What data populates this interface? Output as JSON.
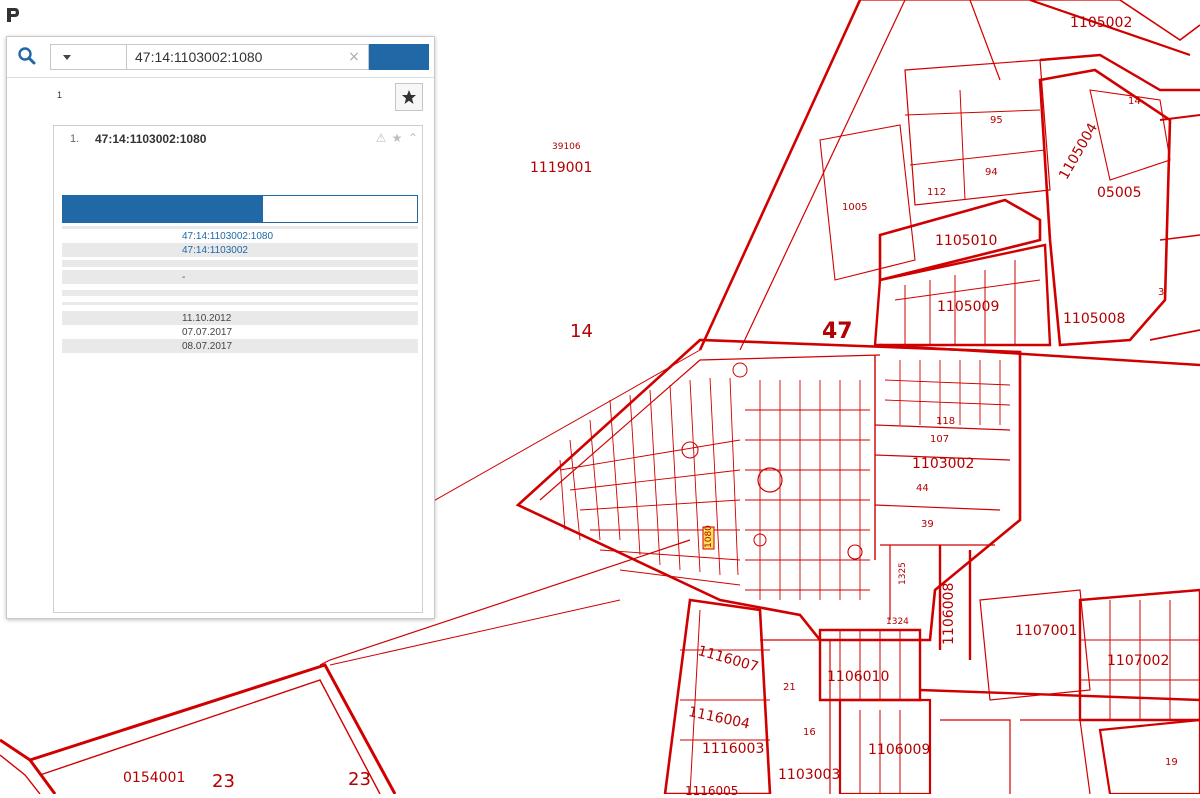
{
  "header": {
    "title": ""
  },
  "search": {
    "type_label": "",
    "query": "47:14:1103002:1080",
    "clear_glyph": "×",
    "button_label": ""
  },
  "results": {
    "title": "",
    "count": "1",
    "favorite_glyph": "★",
    "items": [
      {
        "index": "1.",
        "cad_number": "47:14:1103002:1080",
        "address": "",
        "icons": {
          "warning": "⚠",
          "star": "★",
          "collapse": "⌃"
        },
        "links": {
          "plan_zu": "",
          "plan_kk": "",
          "search_in_bounds": ""
        }
      }
    ]
  },
  "tabs": {
    "info": "",
    "services": ""
  },
  "info": {
    "rows": [
      {
        "key": "",
        "value": ""
      },
      {
        "key": "",
        "value": "47:14:1103002:1080"
      },
      {
        "key": "",
        "value": "47:14:1103002"
      },
      {
        "key": "",
        "value": ""
      },
      {
        "key": "",
        "value": ""
      },
      {
        "key": "",
        "value": ""
      },
      {
        "key": "",
        "value": "-"
      },
      {
        "key": "",
        "value": ""
      },
      {
        "key": "",
        "value": ""
      },
      {
        "key": "",
        "value": ""
      },
      {
        "key": "",
        "value": ""
      },
      {
        "key": "",
        "value": ""
      },
      {
        "key": "",
        "value": "11.10.2012"
      },
      {
        "key": "",
        "value": "07.07.2017"
      },
      {
        "key": "",
        "value": "08.07.2017"
      }
    ]
  },
  "map": {
    "labels": [
      {
        "text": "1105002"
      },
      {
        "text": "39106"
      },
      {
        "text": "1119001"
      },
      {
        "text": "95"
      },
      {
        "text": "94"
      },
      {
        "text": "112"
      },
      {
        "text": "1005"
      },
      {
        "text": ""
      },
      {
        "text": "05005"
      },
      {
        "text": "1105010"
      },
      {
        "text": "1105009"
      },
      {
        "text": "1105008"
      },
      {
        "text": "14"
      },
      {
        "text": "47"
      },
      {
        "text": "107"
      },
      {
        "text": "118"
      },
      {
        "text": "1103002"
      },
      {
        "text": "44"
      },
      {
        "text": "39"
      },
      {
        "text": "1325"
      },
      {
        "text": "1324"
      },
      {
        "text": "1106008"
      },
      {
        "text": "1107001"
      },
      {
        "text": "1107002"
      },
      {
        "text": "1116007"
      },
      {
        "text": "1106010"
      },
      {
        "text": "21"
      },
      {
        "text": "1116004"
      },
      {
        "text": "16"
      },
      {
        "text": "1116003"
      },
      {
        "text": "1106009"
      },
      {
        "text": ""
      },
      {
        "text": "1103003"
      },
      {
        "text": "0154001"
      },
      {
        "text": "23"
      },
      {
        "text": "23"
      },
      {
        "text": "1080"
      },
      {
        "text": "1105004"
      },
      {
        "text": "3"
      },
      {
        "text": "14"
      },
      {
        "text": "19"
      },
      {
        "text": "1116005"
      }
    ],
    "colors": {
      "boundary": "#d10000",
      "highlight": "#ffe25a",
      "panel_accent": "#2168a6"
    }
  }
}
